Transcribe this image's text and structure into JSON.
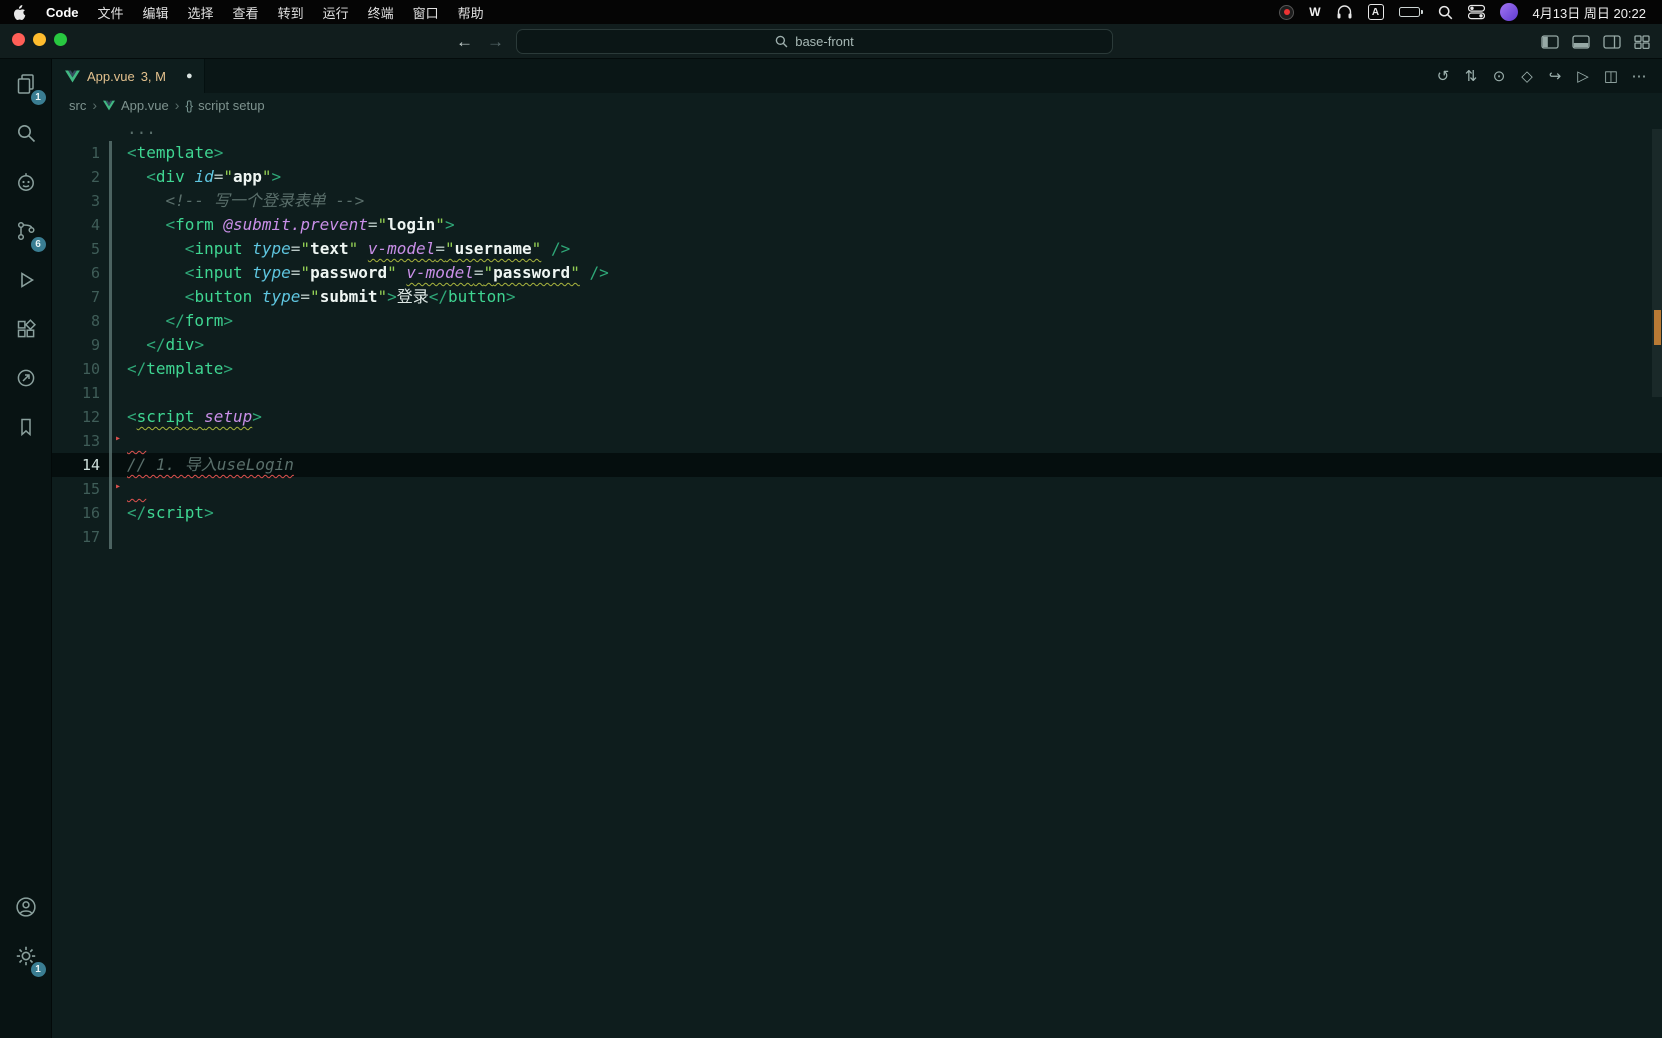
{
  "menubar": {
    "app_menu": "Code",
    "items": [
      "文件",
      "编辑",
      "选择",
      "查看",
      "转到",
      "运行",
      "终端",
      "窗口",
      "帮助"
    ],
    "status": {
      "w_app": "W",
      "input_source": "A",
      "datetime": "4月13日 周日 20:22"
    }
  },
  "titlebar": {
    "command_center": "base-front"
  },
  "tabbar": {
    "tab": {
      "label": "App.vue",
      "decoration": "3, M"
    },
    "actions": [
      {
        "name": "timeline-icon",
        "glyph": "↺"
      },
      {
        "name": "source-control-graph-icon",
        "glyph": "⇅"
      },
      {
        "name": "open-changes-icon",
        "glyph": "⊙"
      },
      {
        "name": "symbol-outline-icon",
        "glyph": "◇"
      },
      {
        "name": "goto-icon",
        "glyph": "↪"
      },
      {
        "name": "run-file-icon",
        "glyph": "▷"
      },
      {
        "name": "split-editor-icon",
        "glyph": "◫"
      },
      {
        "name": "more-actions-icon",
        "glyph": "⋯"
      }
    ]
  },
  "breadcrumb": {
    "folder": "src",
    "file": "App.vue",
    "symbol_brackets": "{}",
    "symbol": "script setup"
  },
  "activity_bar": {
    "badges": {
      "explorer": "1",
      "source_control": "6",
      "settings": "1"
    }
  },
  "editor": {
    "fold_hint": "...",
    "lines": [
      {
        "n": "",
        "t": [
          [
            "fold",
            "..."
          ]
        ]
      },
      {
        "n": "1",
        "git": true,
        "t": [
          [
            "pt",
            "<"
          ],
          [
            "tg",
            "template"
          ],
          [
            "pt",
            ">"
          ]
        ]
      },
      {
        "n": "2",
        "git": true,
        "t": [
          [
            "ws",
            "  "
          ],
          [
            "pt",
            "<"
          ],
          [
            "tg",
            "div"
          ],
          [
            "ws",
            " "
          ],
          [
            "at",
            "id"
          ],
          [
            "eq",
            "="
          ],
          [
            "qt",
            "\""
          ],
          [
            "st",
            "app"
          ],
          [
            "qt",
            "\""
          ],
          [
            "pt",
            ">"
          ]
        ]
      },
      {
        "n": "3",
        "git": true,
        "t": [
          [
            "ws",
            "    "
          ],
          [
            "cm",
            "<!-- 写一个登录表单 -->"
          ]
        ]
      },
      {
        "n": "4",
        "git": true,
        "t": [
          [
            "ws",
            "    "
          ],
          [
            "pt",
            "<"
          ],
          [
            "tg",
            "form"
          ],
          [
            "ws",
            " "
          ],
          [
            "dr",
            "@submit.prevent"
          ],
          [
            "eq",
            "="
          ],
          [
            "qt",
            "\""
          ],
          [
            "st",
            "login"
          ],
          [
            "qt",
            "\""
          ],
          [
            "pt",
            ">"
          ]
        ]
      },
      {
        "n": "5",
        "git": true,
        "t": [
          [
            "ws",
            "      "
          ],
          [
            "pt",
            "<"
          ],
          [
            "tg",
            "input"
          ],
          [
            "ws",
            " "
          ],
          [
            "at",
            "type"
          ],
          [
            "eq",
            "="
          ],
          [
            "qt",
            "\""
          ],
          [
            "st",
            "text"
          ],
          [
            "qt",
            "\""
          ],
          [
            "ws",
            " "
          ],
          [
            "dr warn",
            "v-model"
          ],
          [
            "eq warn",
            "="
          ],
          [
            "qt warn",
            "\""
          ],
          [
            "st warn",
            "username"
          ],
          [
            "qt warn",
            "\""
          ],
          [
            "ws",
            " "
          ],
          [
            "pt",
            "/>"
          ]
        ]
      },
      {
        "n": "6",
        "git": true,
        "t": [
          [
            "ws",
            "      "
          ],
          [
            "pt",
            "<"
          ],
          [
            "tg",
            "input"
          ],
          [
            "ws",
            " "
          ],
          [
            "at",
            "type"
          ],
          [
            "eq",
            "="
          ],
          [
            "qt",
            "\""
          ],
          [
            "st",
            "password"
          ],
          [
            "qt",
            "\""
          ],
          [
            "ws",
            " "
          ],
          [
            "dr warn",
            "v-model"
          ],
          [
            "eq warn",
            "="
          ],
          [
            "qt warn",
            "\""
          ],
          [
            "st warn",
            "password"
          ],
          [
            "qt warn",
            "\""
          ],
          [
            "ws",
            " "
          ],
          [
            "pt",
            "/>"
          ]
        ]
      },
      {
        "n": "7",
        "git": true,
        "t": [
          [
            "ws",
            "      "
          ],
          [
            "pt",
            "<"
          ],
          [
            "tg",
            "button"
          ],
          [
            "ws",
            " "
          ],
          [
            "at",
            "type"
          ],
          [
            "eq",
            "="
          ],
          [
            "qt",
            "\""
          ],
          [
            "st",
            "submit"
          ],
          [
            "qt",
            "\""
          ],
          [
            "pt",
            ">"
          ],
          [
            "tx",
            "登录"
          ],
          [
            "pt",
            "</"
          ],
          [
            "tg",
            "button"
          ],
          [
            "pt",
            ">"
          ]
        ]
      },
      {
        "n": "8",
        "git": true,
        "t": [
          [
            "ws",
            "    "
          ],
          [
            "pt",
            "</"
          ],
          [
            "tg",
            "form"
          ],
          [
            "pt",
            ">"
          ]
        ]
      },
      {
        "n": "9",
        "git": true,
        "t": [
          [
            "ws",
            "  "
          ],
          [
            "pt",
            "</"
          ],
          [
            "tg",
            "div"
          ],
          [
            "pt",
            ">"
          ]
        ]
      },
      {
        "n": "10",
        "git": true,
        "t": [
          [
            "pt",
            "</"
          ],
          [
            "tg",
            "template"
          ],
          [
            "pt",
            ">"
          ]
        ]
      },
      {
        "n": "11",
        "git": true,
        "t": []
      },
      {
        "n": "12",
        "git": true,
        "t": [
          [
            "pt",
            "<"
          ],
          [
            "tg warn",
            "script"
          ],
          [
            "ws warn",
            " "
          ],
          [
            "kw warn",
            "setup"
          ],
          [
            "pt",
            ">"
          ]
        ]
      },
      {
        "n": "13",
        "git": true,
        "mark": true,
        "t": [
          [
            "err",
            "  "
          ]
        ]
      },
      {
        "n": "14",
        "git": true,
        "current": true,
        "t": [
          [
            "cm err",
            "// 1. 导入useLogin"
          ]
        ]
      },
      {
        "n": "15",
        "git": true,
        "mark": true,
        "t": [
          [
            "err",
            "  "
          ]
        ]
      },
      {
        "n": "16",
        "git": true,
        "t": [
          [
            "pt",
            "</"
          ],
          [
            "tg",
            "script"
          ],
          [
            "pt",
            ">"
          ]
        ]
      },
      {
        "n": "17",
        "git": true,
        "t": []
      }
    ]
  },
  "colors": {
    "vue_green": "#41b883",
    "modified_tab": "#e2c08d",
    "error": "#e0524f",
    "warning_squiggle": "#a9b53e",
    "overview_modified_mark": "#b97a35",
    "badge": "#3a7d92"
  }
}
